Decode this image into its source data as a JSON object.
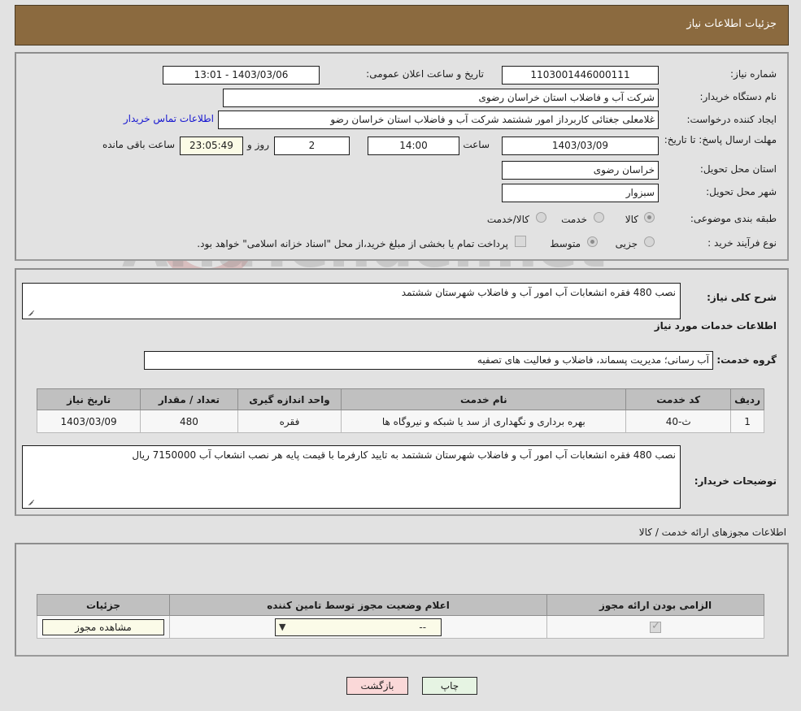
{
  "header": {
    "title": "جزئیات اطلاعات نیاز"
  },
  "top_form": {
    "labels": {
      "need_number": "شماره نیاز:",
      "buyer_org": "نام دستگاه خریدار:",
      "request_creator": "ایجاد کننده درخواست:",
      "response_deadline": "مهلت ارسال پاسخ: تا تاریخ:",
      "delivery_province": "استان محل تحویل:",
      "delivery_city": "شهر محل تحویل:",
      "subject_category": "طبقه بندی موضوعی:",
      "purchase_process_type": "نوع فرآیند خرید :",
      "public_announce_datetime": "تاریخ و ساعت اعلان عمومی:",
      "hour": "ساعت",
      "day_and": "روز و",
      "hours_remaining": "ساعت باقی مانده"
    },
    "values": {
      "need_number": "1103001446000111",
      "buyer_org": "شرکت آب و فاضلاب استان خراسان رضوی",
      "request_creator": "غلامعلی جغتائی کاربرداز امور ششتمد  شرکت آب و فاضلاب استان خراسان رضو",
      "response_deadline_date": "1403/03/09",
      "response_deadline_hour": "14:00",
      "days_remaining": "2",
      "time_remaining": "23:05:49",
      "delivery_province": "خراسان رضوی",
      "delivery_city": "سبزوار",
      "public_announce_datetime": "1403/03/06 - 13:01"
    },
    "buyer_contact_link": "اطلاعات تماس خریدار",
    "subject_category_options": [
      {
        "label": "کالا",
        "selected": false
      },
      {
        "label": "خدمت",
        "selected": true
      },
      {
        "label": "کالا/خدمت",
        "selected": false
      }
    ],
    "purchase_process_options": [
      {
        "label": "جزیی",
        "selected": false
      },
      {
        "label": "متوسط",
        "selected": true
      }
    ],
    "treasury_checkbox": {
      "checked": false,
      "text": "پرداخت تمام یا بخشی از مبلغ خرید،از محل \"اسناد خزانه اسلامی\" خواهد بود."
    }
  },
  "need_description": {
    "label": "شرح کلی نیاز:",
    "value": "نصب 480 فقره انشعابات آب امور آب و فاضلاب شهرستان ششتمد"
  },
  "services_section": {
    "title": "اطلاعات خدمات مورد نیاز",
    "service_group_label": "گروه خدمت:",
    "service_group_value": "آب رسانی؛ مدیریت پسماند، فاضلاب و فعالیت های تصفیه",
    "table": {
      "headers": [
        "ردیف",
        "کد خدمت",
        "نام خدمت",
        "واحد اندازه گیری",
        "تعداد / مقدار",
        "تاریخ نیاز"
      ],
      "rows": [
        {
          "row_no": "1",
          "service_code": "ث-40",
          "service_name": "بهره برداری و نگهداری از سد یا شبکه و نیروگاه ها",
          "unit": "فقره",
          "quantity": "480",
          "need_date": "1403/03/09"
        }
      ]
    }
  },
  "buyer_notes": {
    "label": "توضیحات خریدار:",
    "value": "نصب 480 فقره انشعابات آب امور آب و فاضلاب شهرستان ششتمد  به تایید کارفرما با قیمت پایه هر نصب انشعاب آب 7150000 ریال"
  },
  "permits_section": {
    "title": "اطلاعات مجوزهای ارائه خدمت / کالا",
    "table": {
      "headers": [
        "الزامی بودن ارائه مجوز",
        "اعلام وضعیت مجوز توسط تامین کننده",
        "جزئیات"
      ],
      "rows": [
        {
          "required_checked": true,
          "status_value": "--",
          "details_button": "مشاهده مجوز"
        }
      ]
    }
  },
  "footer": {
    "print_button": "چاپ",
    "back_button": "بازگشت"
  },
  "watermark": {
    "text": "AriaTender.net"
  },
  "colors": {
    "header_bg": "#8b6a3f",
    "page_bg": "#e2e2e2",
    "link": "#1515d0",
    "print_btn": "#e6f4e3",
    "back_btn": "#fad8d8",
    "cream_field": "#fbfbe6",
    "table_header": "#c0c0c0"
  }
}
